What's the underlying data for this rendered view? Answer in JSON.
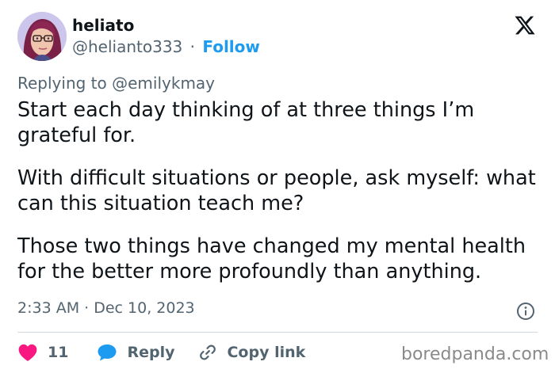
{
  "author": {
    "name": "heliato",
    "handle": "@helianto333",
    "separator": "·",
    "follow_label": "Follow"
  },
  "reply_context": {
    "prefix": "Replying to ",
    "mention": "@emilykmay"
  },
  "tweet": {
    "paragraphs": [
      "Start each day thinking of at three things I’m grateful for.",
      "With difficult situations or people, ask myself: what can this situation teach me?",
      "Those two things have changed my mental health for the better more profoundly than anything."
    ],
    "timestamp": "2:33 AM · Dec 10, 2023"
  },
  "actions": {
    "like_count": "11",
    "reply_label": "Reply",
    "copy_link_label": "Copy link"
  },
  "watermark": "boredpanda.com",
  "colors": {
    "like": "#f91880",
    "reply": "#1d9bf0",
    "follow": "#1d9bf0",
    "secondary_text": "#536471"
  },
  "icons": {
    "brand": "x-logo-icon",
    "info": "info-icon",
    "like": "heart-icon",
    "reply": "speech-bubble-icon",
    "copy": "link-icon"
  }
}
